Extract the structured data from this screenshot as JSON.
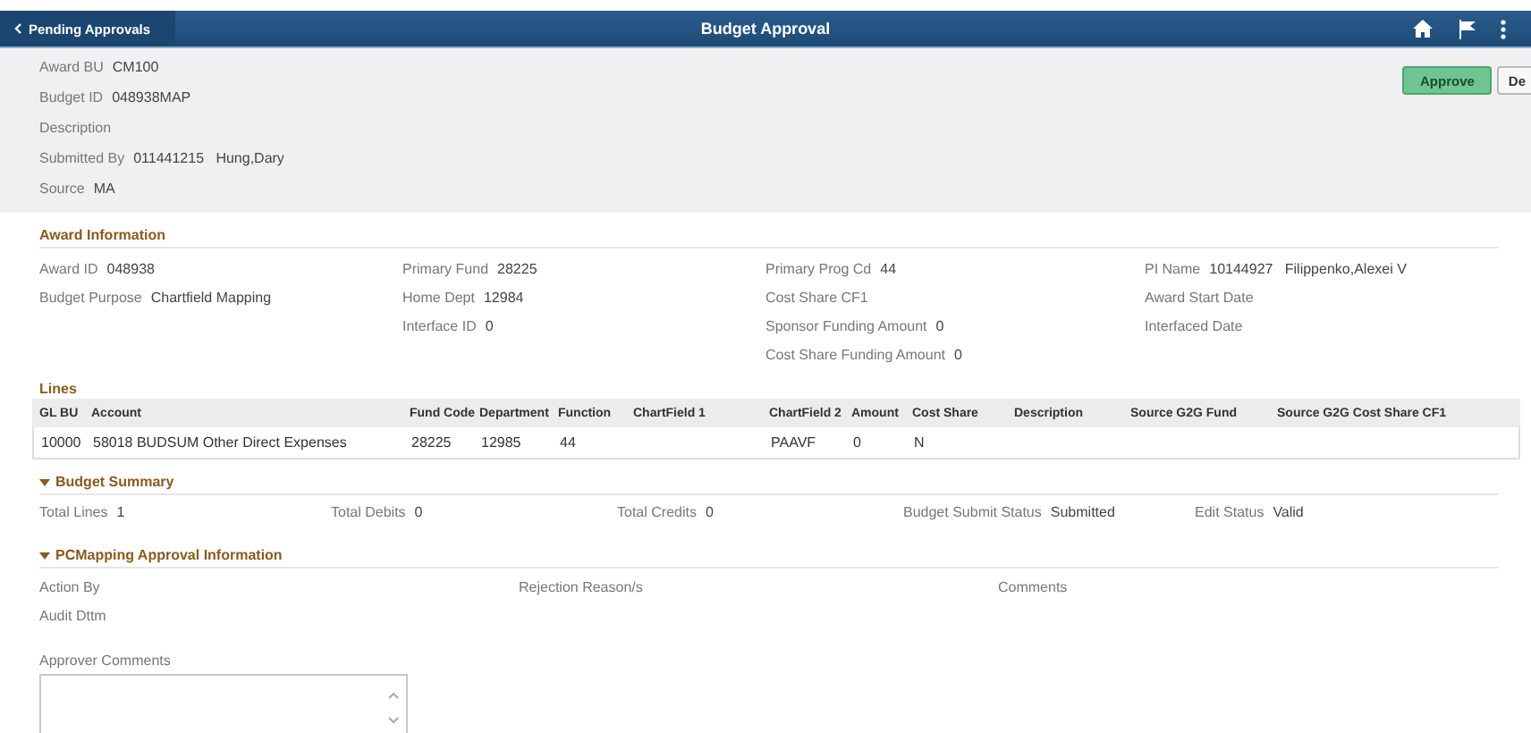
{
  "header": {
    "back_label": "Pending Approvals",
    "title": "Budget Approval"
  },
  "record": {
    "fields": [
      {
        "label": "Award BU",
        "value": "CM100"
      },
      {
        "label": "Budget ID",
        "value": "048938MAP"
      },
      {
        "label": "Description"
      },
      {
        "label": "Submitted By",
        "value": "011441215   Hung,Dary"
      },
      {
        "label": "Source",
        "value": "MA"
      }
    ],
    "buttons": [
      {
        "label": "Approve",
        "kind": "primary"
      },
      {
        "label": "De",
        "kind": "secondary"
      }
    ]
  },
  "award_information": {
    "title": "Award Information",
    "columns": [
      [
        {
          "label": "Award ID",
          "value": "048938"
        },
        {
          "label": "Budget Purpose",
          "value": "Chartfield Mapping"
        }
      ],
      [
        {
          "label": "Primary Fund",
          "value": "28225"
        },
        {
          "label": "Home Dept",
          "value": "12984"
        },
        {
          "label": "Interface ID",
          "value": "0"
        }
      ],
      [
        {
          "label": "Primary Prog Cd",
          "value": "44"
        },
        {
          "label": "Cost Share CF1"
        },
        {
          "label": "Sponsor Funding Amount",
          "value": "0"
        },
        {
          "label": "Cost Share Funding Amount",
          "value": "0"
        }
      ],
      [
        {
          "label": "PI Name",
          "value": "10144927   Filippenko,Alexei V"
        },
        {
          "label": "Award Start Date"
        },
        {
          "label": "Interfaced Date"
        }
      ]
    ]
  },
  "lines": {
    "title": "Lines",
    "columns": [
      "GL BU",
      "Account",
      "Fund Code",
      "Department",
      "Function",
      "ChartField 1",
      "ChartField 2",
      "Amount",
      "Cost Share",
      "Description",
      "Source G2G Fund",
      "Source G2G Cost Share CF1"
    ],
    "rows": [
      [
        "10000",
        "58018 BUDSUM Other Direct Expenses",
        "28225",
        "12985",
        "44",
        "",
        "PAAVF",
        "0",
        "N",
        "",
        "",
        ""
      ]
    ]
  },
  "budget_summary": {
    "title": "Budget Summary",
    "expanded": true,
    "fields": [
      {
        "label": "Total Lines",
        "value": "1"
      },
      {
        "label": "Total Debits",
        "value": "0"
      },
      {
        "label": "Total Credits",
        "value": "0"
      },
      {
        "label": "Budget Submit Status",
        "value": "Submitted"
      },
      {
        "label": "Edit Status",
        "value": "Valid"
      }
    ]
  },
  "approval_info": {
    "title": "PCMapping Approval Information",
    "expanded": true,
    "fields": [
      {
        "label": "Action By"
      },
      {
        "label": "Rejection Reason/s"
      },
      {
        "label": "Comments"
      },
      {
        "label": "Audit Dttm"
      }
    ]
  },
  "approver_comments": {
    "label": "Approver Comments"
  }
}
